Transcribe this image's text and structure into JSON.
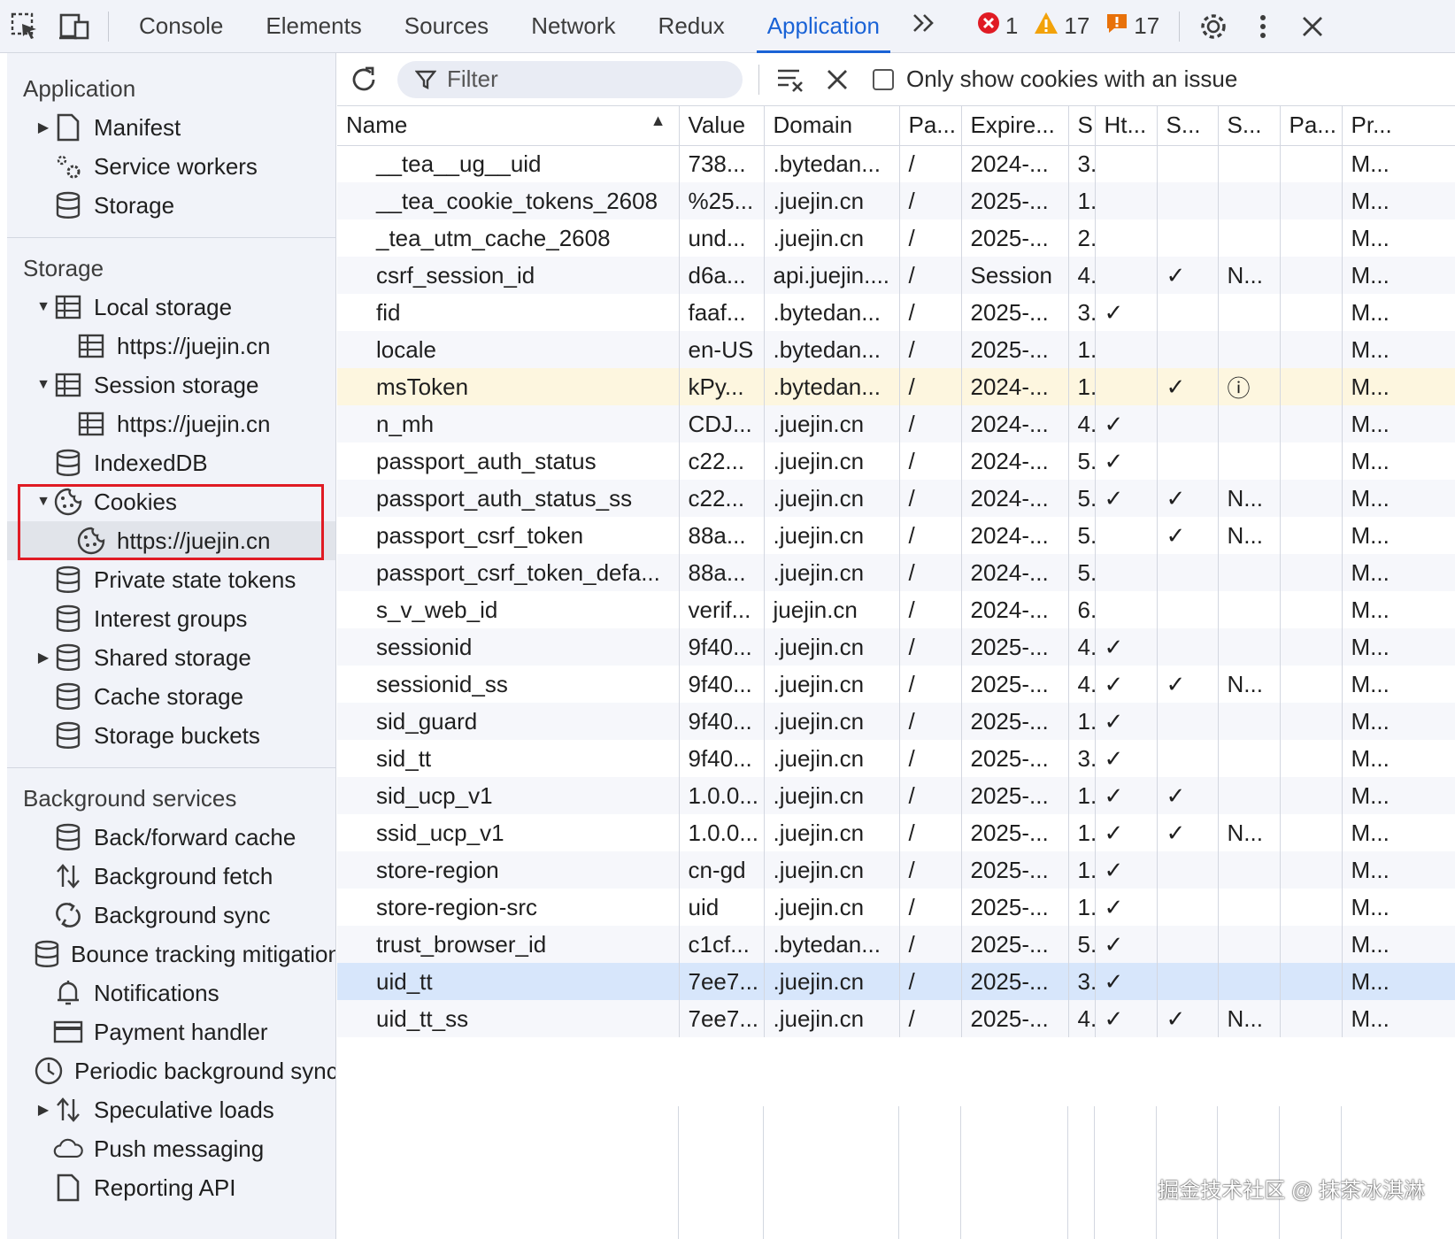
{
  "topbar": {
    "tabs": [
      {
        "label": "Console",
        "active": false
      },
      {
        "label": "Elements",
        "active": false
      },
      {
        "label": "Sources",
        "active": false
      },
      {
        "label": "Network",
        "active": false
      },
      {
        "label": "Redux",
        "active": false
      },
      {
        "label": "Application",
        "active": true
      }
    ],
    "more_label": ">>",
    "errors": "1",
    "warnings": "17",
    "issues": "17",
    "colors": {
      "accent": "#1a63d6",
      "error": "#e01b24",
      "warning": "#f2a20a",
      "issue": "#e8710a"
    }
  },
  "sidebar": {
    "app_title": "Application",
    "app_items": [
      {
        "label": "Manifest",
        "icon": "file-icon",
        "arrow": "▶"
      },
      {
        "label": "Service workers",
        "icon": "gears-icon",
        "arrow": ""
      },
      {
        "label": "Storage",
        "icon": "database-icon",
        "arrow": ""
      }
    ],
    "storage_title": "Storage",
    "storage_items": [
      {
        "label": "Local storage",
        "icon": "table-icon",
        "arrow": "▼",
        "level": 0
      },
      {
        "label": "https://juejin.cn",
        "icon": "table-icon",
        "arrow": "",
        "level": 1
      },
      {
        "label": "Session storage",
        "icon": "table-icon",
        "arrow": "▼",
        "level": 0
      },
      {
        "label": "https://juejin.cn",
        "icon": "table-icon",
        "arrow": "",
        "level": 1
      },
      {
        "label": "IndexedDB",
        "icon": "database-icon",
        "arrow": "",
        "level": 0
      },
      {
        "label": "Cookies",
        "icon": "cookie-icon",
        "arrow": "▼",
        "level": 0
      },
      {
        "label": "https://juejin.cn",
        "icon": "cookie-icon",
        "arrow": "",
        "level": 1,
        "selected": true
      },
      {
        "label": "Private state tokens",
        "icon": "database-icon",
        "arrow": "",
        "level": 0
      },
      {
        "label": "Interest groups",
        "icon": "database-icon",
        "arrow": "",
        "level": 0
      },
      {
        "label": "Shared storage",
        "icon": "database-icon",
        "arrow": "▶",
        "level": 0
      },
      {
        "label": "Cache storage",
        "icon": "database-icon",
        "arrow": "",
        "level": 0
      },
      {
        "label": "Storage buckets",
        "icon": "database-icon",
        "arrow": "",
        "level": 0
      }
    ],
    "bg_title": "Background services",
    "bg_items": [
      {
        "label": "Back/forward cache",
        "icon": "database-icon",
        "arrow": ""
      },
      {
        "label": "Background fetch",
        "icon": "updown-icon",
        "arrow": ""
      },
      {
        "label": "Background sync",
        "icon": "sync-icon",
        "arrow": ""
      },
      {
        "label": "Bounce tracking mitigations",
        "icon": "database-icon",
        "arrow": ""
      },
      {
        "label": "Notifications",
        "icon": "bell-icon",
        "arrow": ""
      },
      {
        "label": "Payment handler",
        "icon": "card-icon",
        "arrow": ""
      },
      {
        "label": "Periodic background sync",
        "icon": "clock-icon",
        "arrow": ""
      },
      {
        "label": "Speculative loads",
        "icon": "updown-icon",
        "arrow": "▶"
      },
      {
        "label": "Push messaging",
        "icon": "cloud-icon",
        "arrow": ""
      },
      {
        "label": "Reporting API",
        "icon": "file-icon",
        "arrow": ""
      }
    ]
  },
  "toolbar": {
    "filter_placeholder": "Filter",
    "only_issue_label": "Only show cookies with an issue"
  },
  "table": {
    "columns": [
      "Name",
      "Value",
      "Domain",
      "Pa...",
      "Expire...",
      "S",
      "Ht...",
      "S...",
      "S...",
      "Pa...",
      "Pr..."
    ],
    "rows": [
      {
        "cells": [
          "__tea__ug__uid",
          "738...",
          ".bytedan...",
          "/",
          "2024-...",
          "3.",
          "",
          "",
          "",
          "",
          "M..."
        ]
      },
      {
        "cells": [
          "__tea_cookie_tokens_2608",
          "%25...",
          ".juejin.cn",
          "/",
          "2025-...",
          "1.",
          "",
          "",
          "",
          "",
          "M..."
        ]
      },
      {
        "cells": [
          "_tea_utm_cache_2608",
          "und...",
          ".juejin.cn",
          "/",
          "2025-...",
          "2.",
          "",
          "",
          "",
          "",
          "M..."
        ]
      },
      {
        "cells": [
          "csrf_session_id",
          "d6a...",
          "api.juejin....",
          "/",
          "Session",
          "4.",
          "",
          "✓",
          "N...",
          "",
          "M..."
        ]
      },
      {
        "cells": [
          "fid",
          "faaf...",
          ".bytedan...",
          "/",
          "2025-...",
          "3.",
          "✓",
          "",
          "",
          "",
          "M..."
        ]
      },
      {
        "cells": [
          "locale",
          "en-US",
          ".bytedan...",
          "/",
          "2025-...",
          "1.",
          "",
          "",
          "",
          "",
          "M..."
        ]
      },
      {
        "cells": [
          "msToken",
          "kPy...",
          ".bytedan...",
          "/",
          "2024-...",
          "1.",
          "",
          "✓",
          "ⓘ",
          "",
          "M..."
        ],
        "state": "issue"
      },
      {
        "cells": [
          "n_mh",
          "CDJ...",
          ".juejin.cn",
          "/",
          "2024-...",
          "4.",
          "✓",
          "",
          "",
          "",
          "M..."
        ]
      },
      {
        "cells": [
          "passport_auth_status",
          "c22...",
          ".juejin.cn",
          "/",
          "2024-...",
          "5.",
          "✓",
          "",
          "",
          "",
          "M..."
        ]
      },
      {
        "cells": [
          "passport_auth_status_ss",
          "c22...",
          ".juejin.cn",
          "/",
          "2024-...",
          "5.",
          "✓",
          "✓",
          "N...",
          "",
          "M..."
        ]
      },
      {
        "cells": [
          "passport_csrf_token",
          "88a...",
          ".juejin.cn",
          "/",
          "2024-...",
          "5.",
          "",
          "✓",
          "N...",
          "",
          "M..."
        ]
      },
      {
        "cells": [
          "passport_csrf_token_defa...",
          "88a...",
          ".juejin.cn",
          "/",
          "2024-...",
          "5.",
          "",
          "",
          "",
          "",
          "M..."
        ]
      },
      {
        "cells": [
          "s_v_web_id",
          "verif...",
          "juejin.cn",
          "/",
          "2024-...",
          "6.",
          "",
          "",
          "",
          "",
          "M..."
        ]
      },
      {
        "cells": [
          "sessionid",
          "9f40...",
          ".juejin.cn",
          "/",
          "2025-...",
          "4.",
          "✓",
          "",
          "",
          "",
          "M..."
        ]
      },
      {
        "cells": [
          "sessionid_ss",
          "9f40...",
          ".juejin.cn",
          "/",
          "2025-...",
          "4.",
          "✓",
          "✓",
          "N...",
          "",
          "M..."
        ]
      },
      {
        "cells": [
          "sid_guard",
          "9f40...",
          ".juejin.cn",
          "/",
          "2025-...",
          "1.",
          "✓",
          "",
          "",
          "",
          "M..."
        ]
      },
      {
        "cells": [
          "sid_tt",
          "9f40...",
          ".juejin.cn",
          "/",
          "2025-...",
          "3.",
          "✓",
          "",
          "",
          "",
          "M..."
        ]
      },
      {
        "cells": [
          "sid_ucp_v1",
          "1.0.0...",
          ".juejin.cn",
          "/",
          "2025-...",
          "1.",
          "✓",
          "✓",
          "",
          "",
          "M..."
        ]
      },
      {
        "cells": [
          "ssid_ucp_v1",
          "1.0.0...",
          ".juejin.cn",
          "/",
          "2025-...",
          "1.",
          "✓",
          "✓",
          "N...",
          "",
          "M..."
        ]
      },
      {
        "cells": [
          "store-region",
          "cn-gd",
          ".juejin.cn",
          "/",
          "2025-...",
          "1.",
          "✓",
          "",
          "",
          "",
          "M..."
        ]
      },
      {
        "cells": [
          "store-region-src",
          "uid",
          ".juejin.cn",
          "/",
          "2025-...",
          "1.",
          "✓",
          "",
          "",
          "",
          "M..."
        ]
      },
      {
        "cells": [
          "trust_browser_id",
          "c1cf...",
          ".bytedan...",
          "/",
          "2025-...",
          "5.",
          "✓",
          "",
          "",
          "",
          "M..."
        ]
      },
      {
        "cells": [
          "uid_tt",
          "7ee7...",
          ".juejin.cn",
          "/",
          "2025-...",
          "3.",
          "✓",
          "",
          "",
          "",
          "M..."
        ],
        "state": "selected"
      },
      {
        "cells": [
          "uid_tt_ss",
          "7ee7...",
          ".juejin.cn",
          "/",
          "2025-...",
          "4.",
          "✓",
          "✓",
          "N...",
          "",
          "M..."
        ]
      }
    ]
  },
  "watermark": "掘金技术社区 @ 抹茶冰淇淋"
}
